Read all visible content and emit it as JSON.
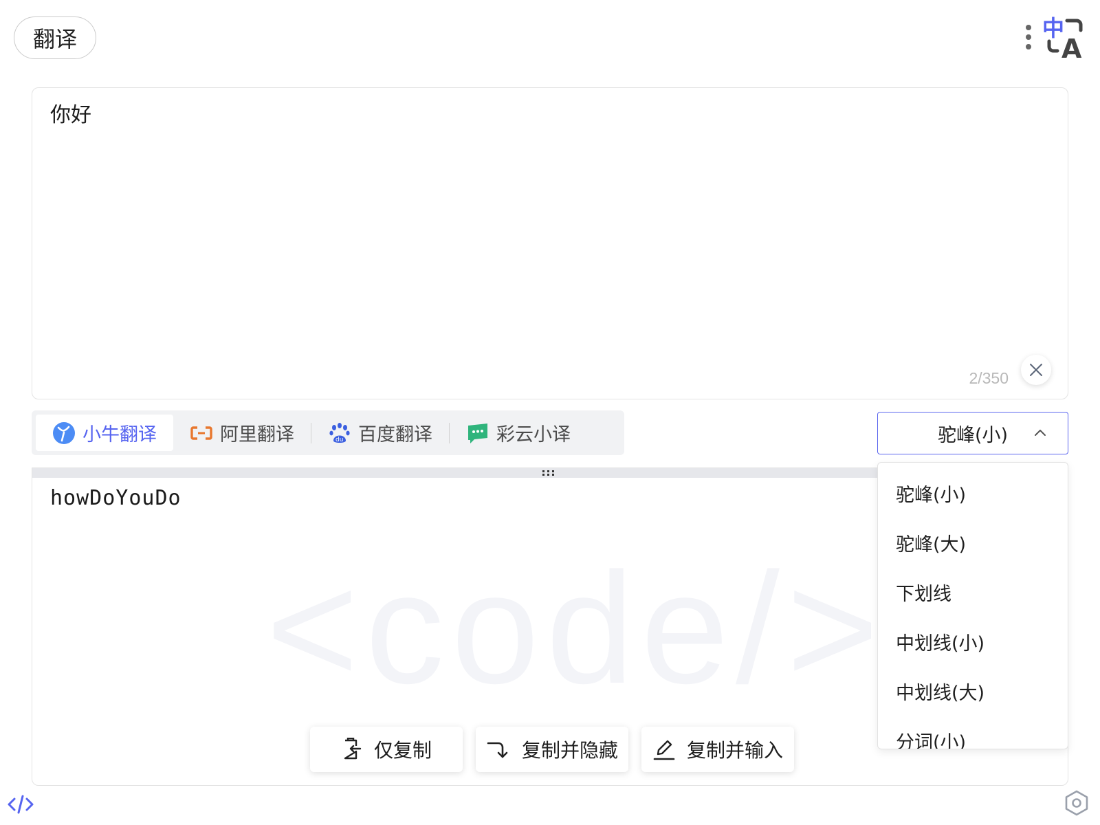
{
  "header": {
    "title": "翻译",
    "logo_text_top": "中",
    "logo_text_bottom": "A"
  },
  "input": {
    "text": "你好",
    "char_count": "2/350"
  },
  "engines": [
    {
      "label": "小牛翻译",
      "icon": "niutrans-icon",
      "active": true
    },
    {
      "label": "阿里翻译",
      "icon": "aliyun-icon",
      "active": false
    },
    {
      "label": "百度翻译",
      "icon": "baidu-paw-icon",
      "active": false
    },
    {
      "label": "彩云小译",
      "icon": "caiyun-icon",
      "active": false
    }
  ],
  "case_select": {
    "selected": "驼峰(小)",
    "options": [
      "驼峰(小)",
      "驼峰(大)",
      "下划线",
      "中划线(小)",
      "中划线(大)",
      "分词(小)"
    ]
  },
  "output": {
    "text": "howDoYouDo",
    "watermark": "<code/>"
  },
  "actions": {
    "copy_only": "仅复制",
    "copy_hide": "复制并隐藏",
    "copy_input": "复制并输入"
  },
  "colors": {
    "accent": "#5664f0",
    "niutrans": "#4c8cf5",
    "aliyun": "#e8772e",
    "baidu": "#3b5fe0",
    "caiyun": "#2fb47c"
  }
}
